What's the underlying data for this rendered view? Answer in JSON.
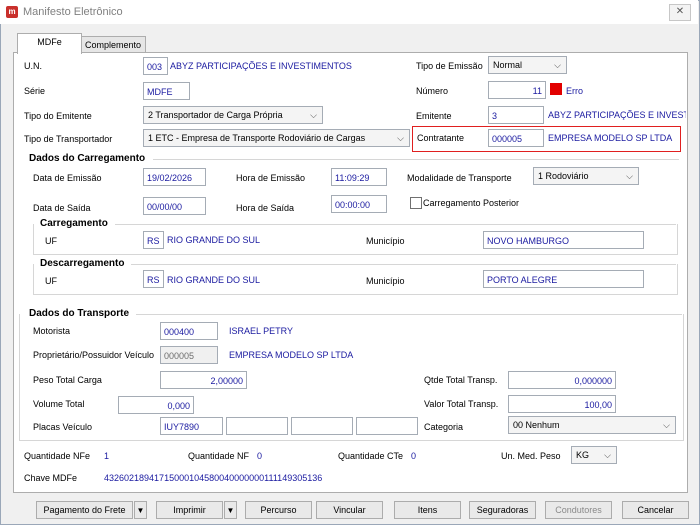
{
  "window": {
    "title": "Manifesto Eletrônico",
    "close": "✕"
  },
  "tabs": [
    {
      "label": "MDFe"
    },
    {
      "label": "Complemento"
    }
  ],
  "header": {
    "un_label": "U.N.",
    "un_code": "003",
    "un_name": "ABYZ PARTICIPAÇÕES E INVESTIMENTOS",
    "serie_label": "Série",
    "serie_value": "MDFE",
    "tipo_emitente_label": "Tipo do Emitente",
    "tipo_emitente_value": "2 Transportador de Carga Própria",
    "tipo_transportador_label": "Tipo de Transportador",
    "tipo_transportador_value": "1 ETC - Empresa de Transporte Rodoviário de Cargas",
    "tipo_emissao_label": "Tipo de Emissão",
    "tipo_emissao_value": "Normal",
    "numero_label": "Número",
    "numero_value": "11",
    "erro_label": "Erro",
    "emitente_label": "Emitente",
    "emitente_code": "3",
    "emitente_name": "ABYZ PARTICIPAÇÕES E INVESTIMENTOS",
    "contratante_label": "Contratante",
    "contratante_code": "000005",
    "contratante_name": "EMPRESA MODELO SP LTDA"
  },
  "carregamento_dados": {
    "title": "Dados do Carregamento",
    "data_emissao_label": "Data de Emissão",
    "data_emissao": "19/02/2026",
    "hora_emissao_label": "Hora de Emissão",
    "hora_emissao": "11:09:29",
    "modalidade_label": "Modalidade de Transporte",
    "modalidade_value": "1 Rodoviário",
    "data_saida_label": "Data de Saída",
    "data_saida": "00/00/00",
    "hora_saida_label": "Hora de Saída",
    "hora_saida": "00:00:00",
    "carregamento_posterior_label": "Carregamento Posterior"
  },
  "carregamento": {
    "title": "Carregamento",
    "uf_label": "UF",
    "uf": "RS",
    "uf_name": "RIO GRANDE DO SUL",
    "municipio_label": "Município",
    "municipio": "NOVO HAMBURGO"
  },
  "descarregamento": {
    "title": "Descarregamento",
    "uf_label": "UF",
    "uf": "RS",
    "uf_name": "RIO GRANDE DO SUL",
    "municipio_label": "Município",
    "municipio": "PORTO ALEGRE"
  },
  "transporte": {
    "title": "Dados do Transporte",
    "motorista_label": "Motorista",
    "motorista_code": "000400",
    "motorista_name": "ISRAEL PETRY",
    "proprietario_label": "Proprietário/Possuidor Veículo",
    "proprietario_code": "000005",
    "proprietario_name": "EMPRESA MODELO SP LTDA",
    "peso_label": "Peso Total Carga",
    "peso_value": "2,00000",
    "qtde_label": "Qtde Total Transp.",
    "qtde_value": "0,000000",
    "volume_label": "Volume Total",
    "volume_value": "0,000",
    "valor_label": "Valor Total Transp.",
    "valor_value": "100,00",
    "placas_label": "Placas Veículo",
    "placa1": "IUY7890",
    "categoria_label": "Categoria",
    "categoria_value": "00 Nenhum"
  },
  "footer_info": {
    "nfe_label": "Quantidade NFe",
    "nfe_value": "1",
    "nf_label": "Quantidade NF",
    "nf_value": "0",
    "cte_label": "Quantidade CTe",
    "cte_value": "0",
    "unmed_label": "Un. Med. Peso",
    "unmed_value": "KG",
    "chave_label": "Chave MDFe",
    "chave_value": "43260218941715000104580040000000111149305136"
  },
  "buttons": {
    "pagamento": "Pagamento do Frete",
    "imprimir": "Imprimir",
    "percurso": "Percurso",
    "vincular": "Vincular",
    "itens": "Itens",
    "seguradoras": "Seguradoras",
    "condutores": "Condutores",
    "cancelar": "Cancelar"
  },
  "colors": {
    "value_text": "#1a1aa0",
    "error": "#e20000",
    "highlight_border": "#e01f1f"
  }
}
